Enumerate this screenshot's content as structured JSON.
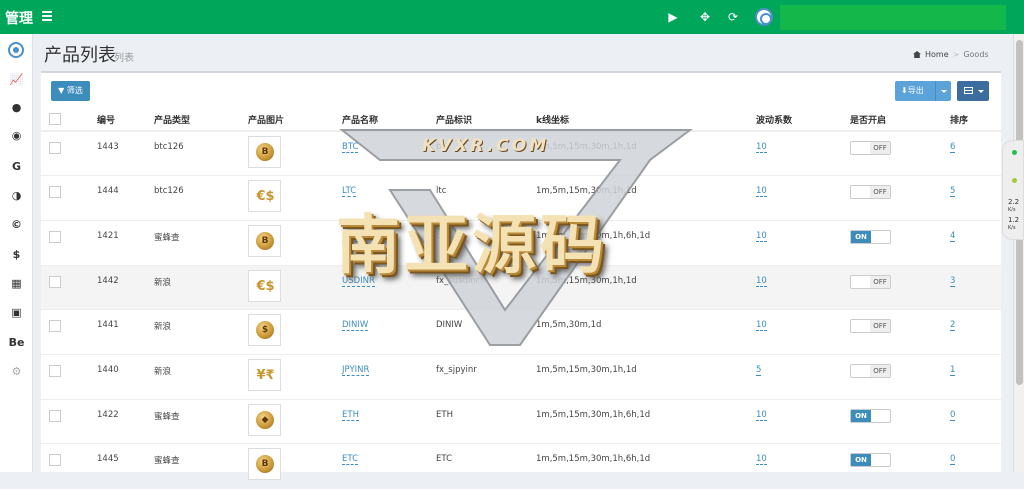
{
  "header": {
    "brand": "管理"
  },
  "page": {
    "title": "产品列表",
    "subtitle": "列表"
  },
  "breadcrumb": {
    "home": "Home",
    "current": "Goods"
  },
  "toolbar": {
    "filter_label": "筛选",
    "export_label": "导出"
  },
  "columns": [
    "编号",
    "产品类型",
    "产品图片",
    "产品名称",
    "产品标识",
    "k线坐标",
    "波动系数",
    "是否开启",
    "排序"
  ],
  "rows": [
    {
      "id": "1443",
      "type": "btc126",
      "icon": "bitcoin-coin",
      "name": "BTC",
      "code": "btc",
      "kline": "1m,5m,15m,30m,1h,1d",
      "vol": "10",
      "on": false,
      "sort": "6"
    },
    {
      "id": "1444",
      "type": "btc126",
      "icon": "euro-dollar",
      "name": "LTC",
      "code": "ltc",
      "kline": "1m,5m,15m,30m,1h,1d",
      "vol": "10",
      "on": false,
      "sort": "5"
    },
    {
      "id": "1421",
      "type": "蜜蜂查",
      "icon": "bitcoin-coin",
      "name": "BTC",
      "code": "BTC",
      "kline": "1m,5m,15m,30m,1h,6h,1d",
      "vol": "10",
      "on": true,
      "sort": "4"
    },
    {
      "id": "1442",
      "type": "新浪",
      "icon": "euro-dollar",
      "name": "USDINR",
      "code": "fx_susdinr",
      "kline": "1m,5m,15m,30m,1h,1d",
      "vol": "10",
      "on": false,
      "sort": "3"
    },
    {
      "id": "1441",
      "type": "新浪",
      "icon": "dollar-coin",
      "name": "DINIW",
      "code": "DINIW",
      "kline": "1m,5m,30m,1d",
      "vol": "10",
      "on": false,
      "sort": "2"
    },
    {
      "id": "1440",
      "type": "新浪",
      "icon": "yen-rupee",
      "name": "JPYINR",
      "code": "fx_sjpyinr",
      "kline": "1m,5m,15m,30m,1h,1d",
      "vol": "5",
      "on": false,
      "sort": "1"
    },
    {
      "id": "1422",
      "type": "蜜蜂查",
      "icon": "ethereum-coin",
      "name": "ETH",
      "code": "ETH",
      "kline": "1m,5m,15m,30m,1h,6h,1d",
      "vol": "10",
      "on": true,
      "sort": "0"
    },
    {
      "id": "1445",
      "type": "蜜蜂查",
      "icon": "bitcoin-coin",
      "name": "ETC",
      "code": "ETC",
      "kline": "1m,5m,15m,30m,1h,6h,1d",
      "vol": "10",
      "on": true,
      "sort": "0"
    }
  ],
  "toggle_labels": {
    "on": "ON",
    "off": "OFF"
  },
  "watermark": {
    "cn": "南亚源码",
    "en": "KVXR.COM"
  },
  "side_widget": {
    "a": "2.2",
    "b": "1.2",
    "unit": "K/s"
  },
  "sidebar_icons": [
    "logo-icon",
    "chart-icon",
    "user-icon",
    "circle-icon",
    "google-icon",
    "half-circle-icon",
    "cc-icon",
    "dollar-icon",
    "calculator-icon",
    "image-icon",
    "behance-icon",
    "settings-icon"
  ],
  "sidebar_labels": {
    "google": "G",
    "behance": "Be",
    "dollar": "$"
  },
  "colors": {
    "header": "#00a65a",
    "primary": "#3c8dbc"
  }
}
